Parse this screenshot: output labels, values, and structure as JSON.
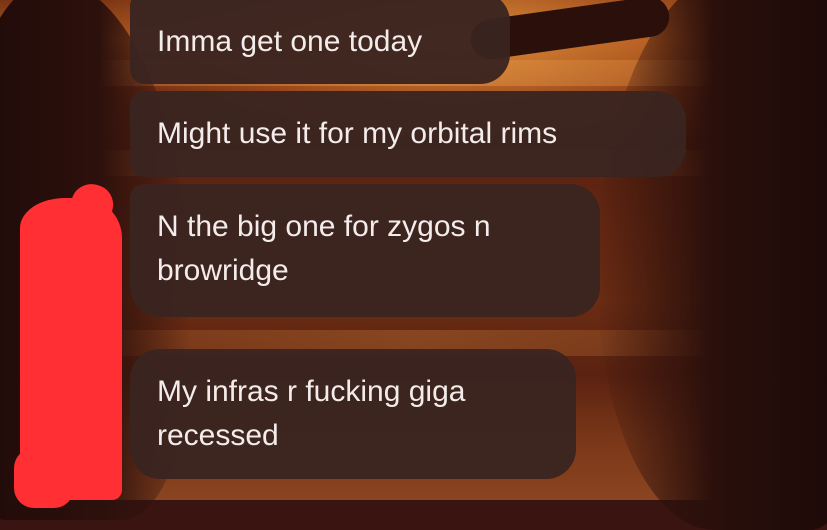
{
  "messages": [
    {
      "text": "Imma get one today"
    },
    {
      "text": "Might use it for my orbital rims"
    },
    {
      "text": "N the big one for zygos n browridge"
    },
    {
      "text": "My infras r fucking giga recessed"
    }
  ],
  "colors": {
    "bubble": "#3a2420",
    "text": "#f3ecea",
    "redaction": "#ff2f33"
  }
}
